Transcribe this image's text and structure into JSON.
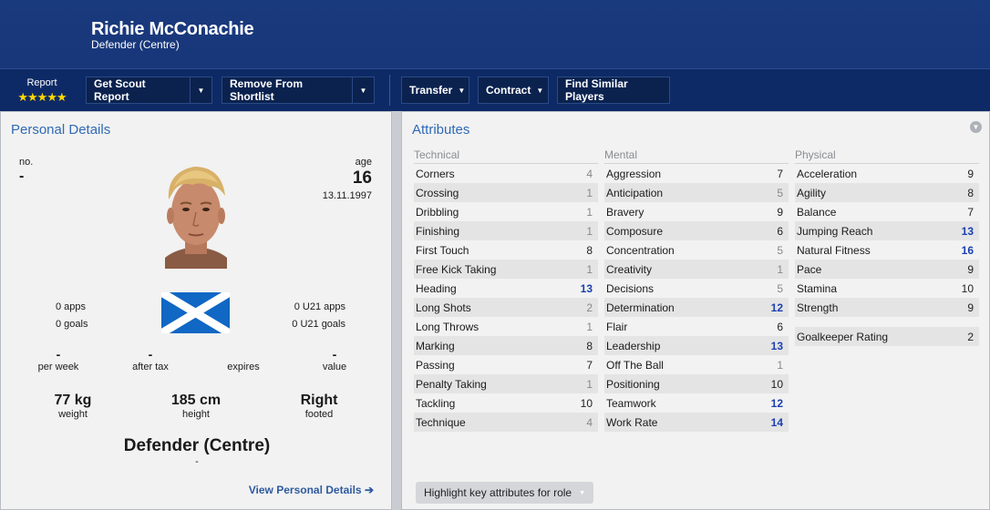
{
  "player": {
    "name": "Richie McConachie",
    "position": "Defender (Centre)"
  },
  "toolbar": {
    "report_label": "Report",
    "report_stars": "★★★★★",
    "scout_report": "Get Scout Report",
    "remove_shortlist": "Remove From Shortlist",
    "transfer": "Transfer",
    "contract": "Contract",
    "find_similar": "Find Similar Players"
  },
  "personal": {
    "title": "Personal Details",
    "no_label": "no.",
    "no_value": "-",
    "age_label": "age",
    "age_value": "16",
    "dob": "13.11.1997",
    "apps": "0 apps",
    "goals": "0 goals",
    "u21_apps": "0 U21 apps",
    "u21_goals": "0 U21 goals",
    "per_week_value": "-",
    "per_week_label": "per week",
    "after_tax_value": "-",
    "after_tax_label": "after tax",
    "expires_value": "",
    "expires_label": "expires",
    "value_value": "-",
    "value_label": "value",
    "weight_value": "77 kg",
    "weight_label": "weight",
    "height_value": "185 cm",
    "height_label": "height",
    "footed_value": "Right",
    "footed_label": "footed",
    "position_big": "Defender (Centre)",
    "position_sub": "-",
    "view_link": "View Personal Details ➔"
  },
  "attributes": {
    "title": "Attributes",
    "technical": {
      "header": "Technical",
      "rows": [
        {
          "name": "Corners",
          "value": "4",
          "level": "low"
        },
        {
          "name": "Crossing",
          "value": "1",
          "level": "low"
        },
        {
          "name": "Dribbling",
          "value": "1",
          "level": "low"
        },
        {
          "name": "Finishing",
          "value": "1",
          "level": "low"
        },
        {
          "name": "First Touch",
          "value": "8",
          "level": "mid"
        },
        {
          "name": "Free Kick Taking",
          "value": "1",
          "level": "low"
        },
        {
          "name": "Heading",
          "value": "13",
          "level": "high"
        },
        {
          "name": "Long Shots",
          "value": "2",
          "level": "low"
        },
        {
          "name": "Long Throws",
          "value": "1",
          "level": "low"
        },
        {
          "name": "Marking",
          "value": "8",
          "level": "mid"
        },
        {
          "name": "Passing",
          "value": "7",
          "level": "mid"
        },
        {
          "name": "Penalty Taking",
          "value": "1",
          "level": "low"
        },
        {
          "name": "Tackling",
          "value": "10",
          "level": "mid"
        },
        {
          "name": "Technique",
          "value": "4",
          "level": "low"
        }
      ]
    },
    "mental": {
      "header": "Mental",
      "rows": [
        {
          "name": "Aggression",
          "value": "7",
          "level": "mid"
        },
        {
          "name": "Anticipation",
          "value": "5",
          "level": "low"
        },
        {
          "name": "Bravery",
          "value": "9",
          "level": "mid"
        },
        {
          "name": "Composure",
          "value": "6",
          "level": "mid"
        },
        {
          "name": "Concentration",
          "value": "5",
          "level": "low"
        },
        {
          "name": "Creativity",
          "value": "1",
          "level": "low"
        },
        {
          "name": "Decisions",
          "value": "5",
          "level": "low"
        },
        {
          "name": "Determination",
          "value": "12",
          "level": "high"
        },
        {
          "name": "Flair",
          "value": "6",
          "level": "mid"
        },
        {
          "name": "Leadership",
          "value": "13",
          "level": "high"
        },
        {
          "name": "Off The Ball",
          "value": "1",
          "level": "low"
        },
        {
          "name": "Positioning",
          "value": "10",
          "level": "mid"
        },
        {
          "name": "Teamwork",
          "value": "12",
          "level": "high"
        },
        {
          "name": "Work Rate",
          "value": "14",
          "level": "high"
        }
      ]
    },
    "physical": {
      "header": "Physical",
      "rows": [
        {
          "name": "Acceleration",
          "value": "9",
          "level": "mid"
        },
        {
          "name": "Agility",
          "value": "8",
          "level": "mid"
        },
        {
          "name": "Balance",
          "value": "7",
          "level": "mid"
        },
        {
          "name": "Jumping Reach",
          "value": "13",
          "level": "high"
        },
        {
          "name": "Natural Fitness",
          "value": "16",
          "level": "high"
        },
        {
          "name": "Pace",
          "value": "9",
          "level": "mid"
        },
        {
          "name": "Stamina",
          "value": "10",
          "level": "mid"
        },
        {
          "name": "Strength",
          "value": "9",
          "level": "mid"
        }
      ],
      "gk_label": "Goalkeeper Rating",
      "gk_value": "2"
    },
    "highlight_button": "Highlight key attributes for role"
  },
  "colors": {
    "header": "#1a3a7e",
    "toolbar": "#0e2a66",
    "accent": "#2f6ab5",
    "high_value": "#1a3fb0"
  }
}
